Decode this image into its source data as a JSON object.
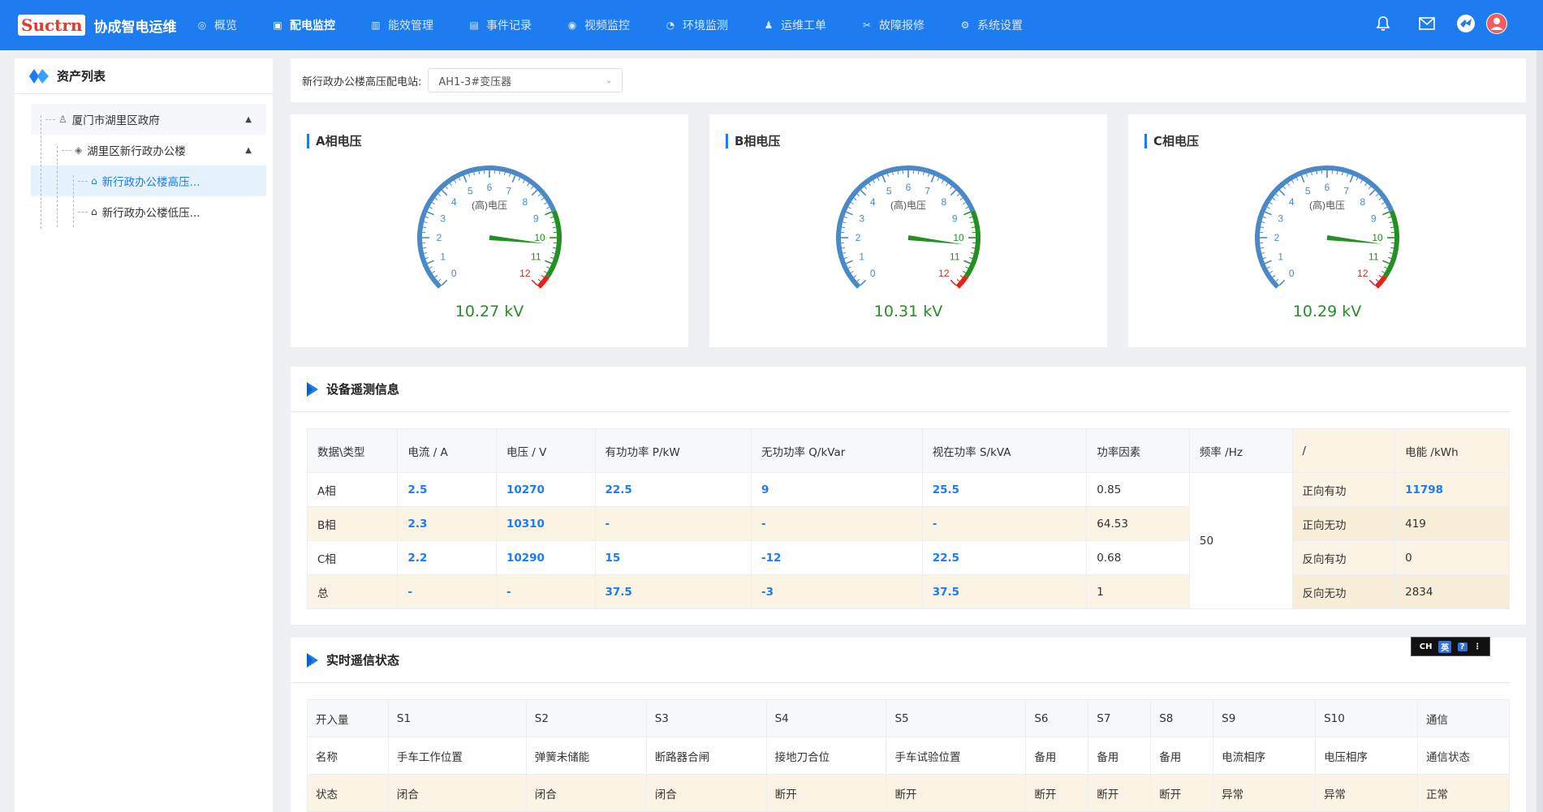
{
  "app": {
    "logo": "Suctrn",
    "title": "协成智电运维"
  },
  "nav": [
    {
      "label": "概览",
      "icon": "dashboard-icon",
      "active": false
    },
    {
      "label": "配电监控",
      "icon": "monitor-icon",
      "active": true
    },
    {
      "label": "能效管理",
      "icon": "bar-chart-icon",
      "active": false
    },
    {
      "label": "事件记录",
      "icon": "list-icon",
      "active": false
    },
    {
      "label": "视频监控",
      "icon": "camera-icon",
      "active": false
    },
    {
      "label": "环境监测",
      "icon": "meter-icon",
      "active": false
    },
    {
      "label": "运维工单",
      "icon": "users-icon",
      "active": false
    },
    {
      "label": "故障报修",
      "icon": "wrench-icon",
      "active": false
    },
    {
      "label": "系统设置",
      "icon": "gear-icon",
      "active": false
    }
  ],
  "sidebar": {
    "title": "资产列表",
    "tree": [
      {
        "label": "厦门市湖里区政府",
        "level": 1,
        "icon": "user-group-icon"
      },
      {
        "label": "湖里区新行政办公楼",
        "level": 2,
        "icon": "layers-icon"
      },
      {
        "label": "新行政办公楼高压...",
        "level": 3,
        "icon": "bank-icon",
        "selected": true
      },
      {
        "label": "新行政办公楼低压...",
        "level": 3,
        "icon": "bank-icon",
        "selected": false
      }
    ]
  },
  "station": {
    "label": "新行政办公楼高压配电站:",
    "selected": "AH1-3#变压器"
  },
  "gauges": [
    {
      "title": "A相电压",
      "inner_label": "(高)电压",
      "value": 10.27,
      "display": "10.27 kV"
    },
    {
      "title": "B相电压",
      "inner_label": "(高)电压",
      "value": 10.31,
      "display": "10.31 kV"
    },
    {
      "title": "C相电压",
      "inner_label": "(高)电压",
      "value": 10.29,
      "display": "10.29 kV"
    }
  ],
  "gauge_scale": {
    "min": 0,
    "max": 12,
    "ticks": [
      "0",
      "1",
      "2",
      "3",
      "4",
      "5",
      "6",
      "7",
      "8",
      "9",
      "10",
      "11",
      "12"
    ],
    "colors": {
      "normal": "#4a89c8",
      "warn": "#229022",
      "danger": "#e2231a"
    }
  },
  "telemetry": {
    "title": "设备遥测信息",
    "headers": [
      "数据\\类型",
      "电流 / A",
      "电压 / V",
      "有功功率 P/kW",
      "无功功率 Q/kVar",
      "视在功率 S/kVA",
      "功率因素",
      "频率 /Hz",
      "/",
      "电能 /kWh"
    ],
    "rows": [
      {
        "name": "A相",
        "current": "2.5",
        "voltage": "10270",
        "p": "22.5",
        "q": "9",
        "s": "25.5",
        "pf": "0.85",
        "energy_type": "正向有功",
        "energy": "11798"
      },
      {
        "name": "B相",
        "current": "2.3",
        "voltage": "10310",
        "p": "-",
        "q": "-",
        "s": "-",
        "pf": "64.53",
        "energy_type": "正向无功",
        "energy": "419"
      },
      {
        "name": "C相",
        "current": "2.2",
        "voltage": "10290",
        "p": "15",
        "q": "-12",
        "s": "22.5",
        "pf": "0.68",
        "energy_type": "反向有功",
        "energy": "0"
      },
      {
        "name": "总",
        "current": "-",
        "voltage": "-",
        "p": "37.5",
        "q": "-3",
        "s": "37.5",
        "pf": "1",
        "energy_type": "反向无功",
        "energy": "2834"
      }
    ],
    "frequency": "50"
  },
  "signals": {
    "title": "实时遥信状态",
    "row_labels": [
      "开入量",
      "名称",
      "状态"
    ],
    "columns": [
      {
        "id": "S1",
        "name": "手车工作位置",
        "state": "闭合"
      },
      {
        "id": "S2",
        "name": "弹簧未储能",
        "state": "闭合"
      },
      {
        "id": "S3",
        "name": "断路器合闸",
        "state": "闭合"
      },
      {
        "id": "S4",
        "name": "接地刀合位",
        "state": "断开"
      },
      {
        "id": "S5",
        "name": "手车试验位置",
        "state": "断开"
      },
      {
        "id": "S6",
        "name": "备用",
        "state": "断开"
      },
      {
        "id": "S7",
        "name": "备用",
        "state": "断开"
      },
      {
        "id": "S8",
        "name": "备用",
        "state": "断开"
      },
      {
        "id": "S9",
        "name": "电流相序",
        "state": "异常"
      },
      {
        "id": "S10",
        "name": "电压相序",
        "state": "异常"
      },
      {
        "id": "通信",
        "name": "通信状态",
        "state": "正常"
      }
    ]
  },
  "ime": {
    "lang": "CH",
    "mode": "英",
    "help": "?"
  }
}
